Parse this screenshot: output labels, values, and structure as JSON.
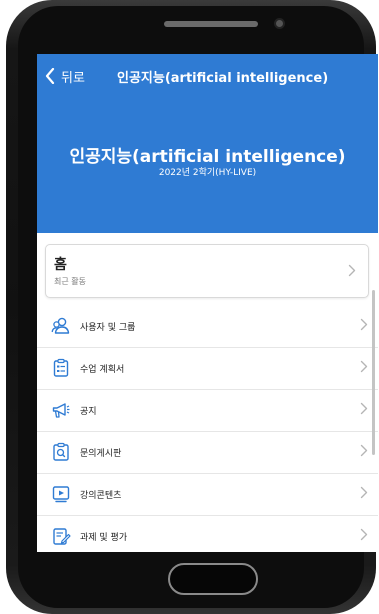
{
  "header": {
    "back_label": "뒤로",
    "nav_title": "인공지능(artificial intelligence)",
    "course_title": "인공지능(artificial intelligence)",
    "course_term": "2022년 2학기(HY-LIVE)",
    "color": "#2f7bd3"
  },
  "home": {
    "title": "홈",
    "subtitle": "최근 활동"
  },
  "menu": {
    "items": [
      {
        "label": "사용자 및 그룹",
        "icon": "users-icon"
      },
      {
        "label": "수업 계획서",
        "icon": "syllabus-icon"
      },
      {
        "label": "공지",
        "icon": "megaphone-icon"
      },
      {
        "label": "문의게시판",
        "icon": "inquiry-board-icon"
      },
      {
        "label": "강의콘텐츠",
        "icon": "video-content-icon"
      },
      {
        "label": "과제 및 평가",
        "icon": "assignment-icon"
      }
    ]
  }
}
